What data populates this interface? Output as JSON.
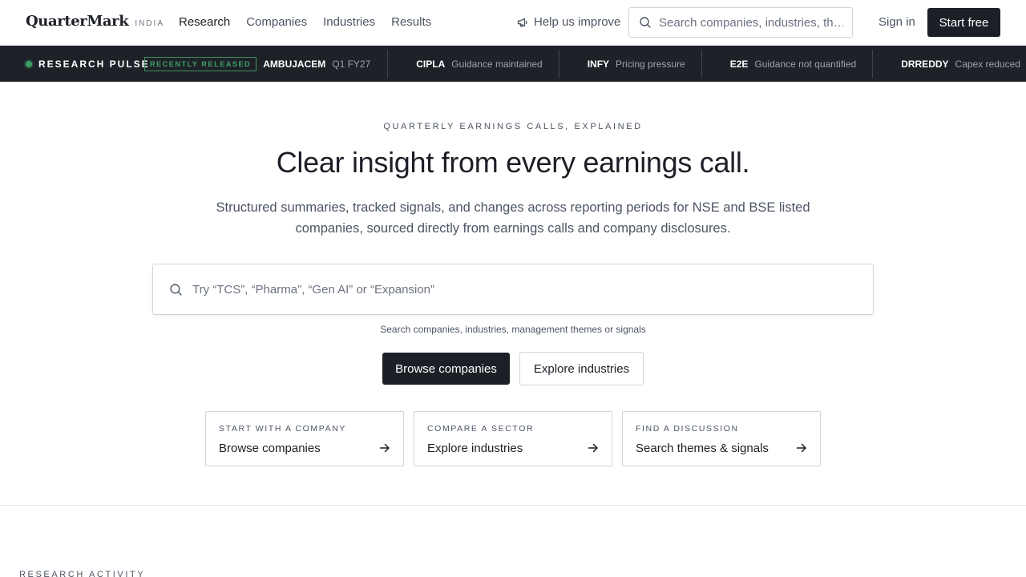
{
  "brand": {
    "name": "QuarterMark",
    "suffix": "INDIA"
  },
  "nav": {
    "links": [
      "Research",
      "Companies",
      "Industries",
      "Results"
    ],
    "help_label": "Help us improve",
    "search_placeholder": "Search companies, industries, th…",
    "signin_label": "Sign in",
    "start_label": "Start free"
  },
  "ticker": {
    "label": "RESEARCH PULSE",
    "badge": "RECENTLY RELEASED",
    "items": [
      {
        "symbol": "AMBUJACEM",
        "text": "Q1 FY27"
      },
      {
        "symbol": "CIPLA",
        "text": "Guidance maintained"
      },
      {
        "symbol": "INFY",
        "text": "Pricing pressure"
      },
      {
        "symbol": "E2E",
        "text": "Guidance not quantified"
      },
      {
        "symbol": "DRREDDY",
        "text": "Capex reduced"
      }
    ]
  },
  "hero": {
    "eyebrow": "QUARTERLY EARNINGS CALLS, EXPLAINED",
    "headline": "Clear insight from every earnings call.",
    "subtitle": "Structured summaries, tracked signals, and changes across reporting periods for NSE and BSE listed companies, sourced directly from earnings calls and company disclosures.",
    "search_placeholder": "Try “TCS”, “Pharma”, “Gen AI” or “Expansion”",
    "search_hint": "Search companies, industries, management themes or signals",
    "primary_button": "Browse companies",
    "secondary_button": "Explore industries"
  },
  "cards": [
    {
      "eyebrow": "START WITH A COMPANY",
      "title": "Browse companies"
    },
    {
      "eyebrow": "COMPARE A SECTOR",
      "title": "Explore industries"
    },
    {
      "eyebrow": "FIND A DISCUSSION",
      "title": "Search themes & signals"
    }
  ],
  "section": {
    "label": "RESEARCH ACTIVITY"
  },
  "colors": {
    "accent": "#1c1f26",
    "ticker_bg": "#1e2228",
    "pulse_green": "#3fa067"
  }
}
